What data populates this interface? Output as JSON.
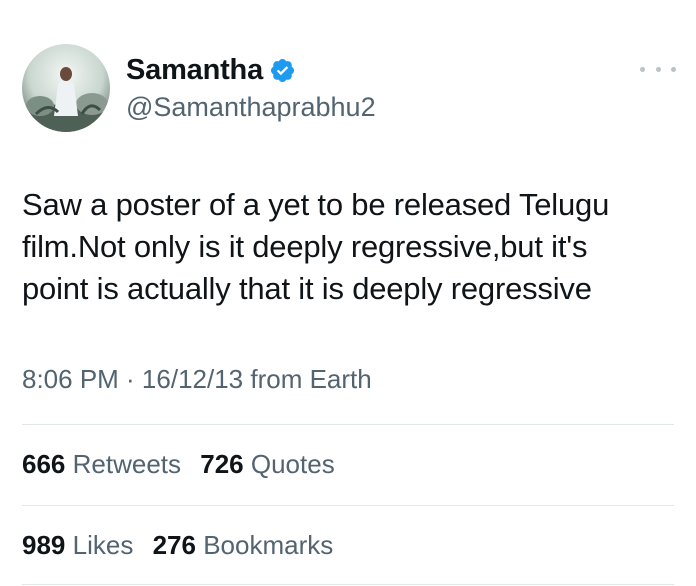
{
  "user": {
    "display_name": "Samantha",
    "handle": "@Samanthaprabhu2",
    "verified_color": "#1d9bf0"
  },
  "tweet": {
    "text_lines": [
      "Saw a poster of a yet to be released Telugu",
      "film.Not only is it deeply regressive,but it's",
      "point is actually that it is deeply regressive"
    ],
    "timestamp": "8:06 PM · 16/12/13 from Earth"
  },
  "stats": {
    "retweets_count": "666",
    "retweets_label": "Retweets",
    "quotes_count": "726",
    "quotes_label": "Quotes",
    "likes_count": "989",
    "likes_label": "Likes",
    "bookmarks_count": "276",
    "bookmarks_label": "Bookmarks"
  },
  "icons": {
    "verified": "verified-badge-icon",
    "more": "more-options-icon"
  }
}
